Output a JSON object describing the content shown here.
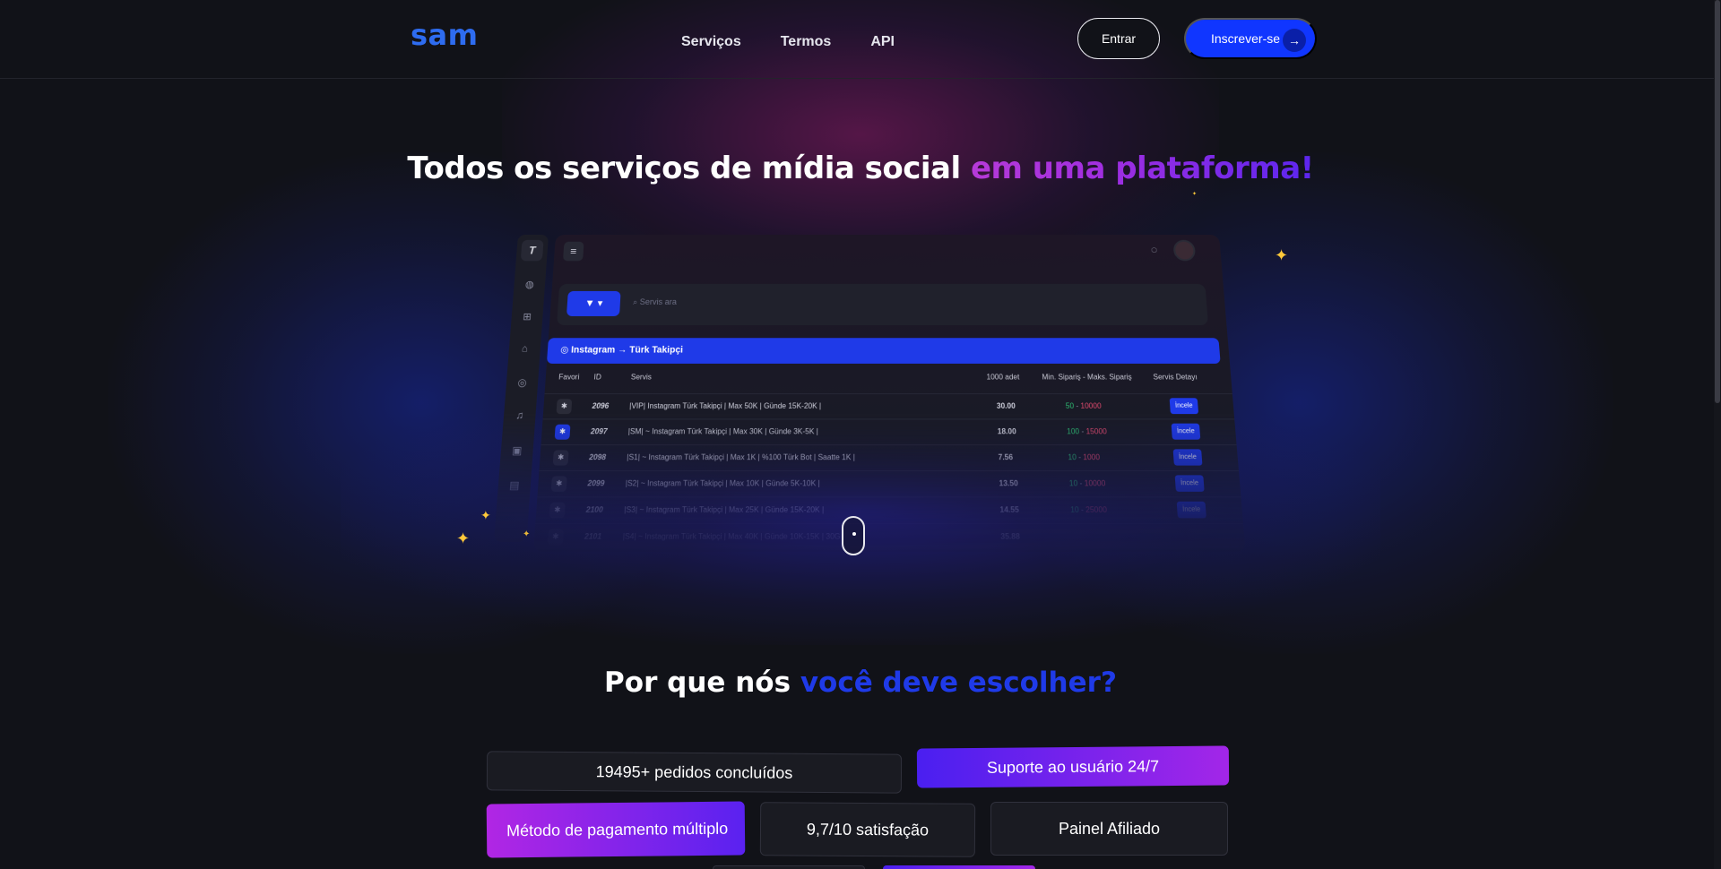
{
  "nav": {
    "logo": "sam",
    "links": [
      "Serviços",
      "Termos",
      "API"
    ],
    "login_label": "Entrar",
    "signup_label": "Inscrever-se"
  },
  "hero": {
    "title_plain": "Todos os serviços de mídia social ",
    "title_highlight": "em uma plataforma!"
  },
  "mockup": {
    "search_placeholder": "Servis ara",
    "category": "Instagram → Türk Takipçi",
    "columns": [
      "Favori",
      "ID",
      "Servis",
      "1000 adet",
      "Min. Sipariş - Maks. Sipariş",
      "Servis Detayı"
    ],
    "rows": [
      {
        "id": "2096",
        "name": "|VIP| Instagram Türk Takipçi | Max 50K | Günde 15K-20K |",
        "price": "30.00",
        "min": "50",
        "max": "10000",
        "fav": false
      },
      {
        "id": "2097",
        "name": "|SM| ~ Instagram Türk Takipçi | Max 30K | Günde 3K-5K |",
        "price": "18.00",
        "min": "100",
        "max": "15000",
        "fav": true
      },
      {
        "id": "2098",
        "name": "|S1| ~ Instagram Türk Takipçi | Max 1K | %100 Türk Bot | Saatte 1K |",
        "price": "7.56",
        "min": "10",
        "max": "1000",
        "fav": false
      },
      {
        "id": "2099",
        "name": "|S2| ~ Instagram Türk Takipçi | Max 10K | Günde 5K-10K |",
        "price": "13.50",
        "min": "10",
        "max": "10000",
        "fav": false
      },
      {
        "id": "2100",
        "name": "|S3| ~ Instagram Türk Takipçi | Max 25K | Günde 15K-20K |",
        "price": "14.55",
        "min": "10",
        "max": "25000",
        "fav": false
      },
      {
        "id": "2101",
        "name": "|S4| ~ Instagram Türk Takipçi | Max 40K | Günde 10K-15K | 30G",
        "price": "35.88",
        "min": "",
        "max": "",
        "fav": false
      }
    ],
    "detail_button": "İncele"
  },
  "why": {
    "title_plain": "Por que nós ",
    "title_highlight": "você deve escolher?",
    "features": [
      "19495+ pedidos concluídos",
      "Suporte ao usuário 24/7",
      "Método de pagamento múltiplo",
      "9,7/10 satisfação",
      "Painel Afiliado"
    ]
  },
  "colors": {
    "brand_blue": "#1036ff",
    "logo_blue": "#2e6cf0",
    "purple": "#a326e8",
    "background": "#111218"
  }
}
